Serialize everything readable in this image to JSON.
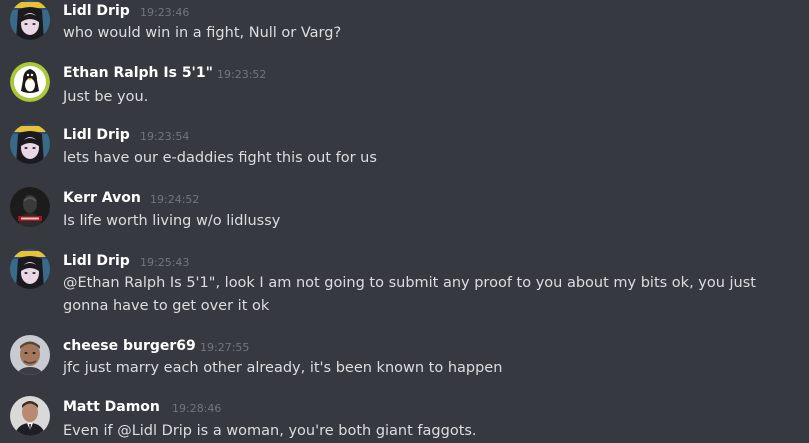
{
  "colors": {
    "background": "#36393f",
    "username": "#ffffff",
    "text": "#dcddde",
    "timestamp": "#72767d"
  },
  "messages": [
    {
      "author": "Lidl Drip",
      "time": "19:23:46",
      "text": "who would win in a fight, Null or Varg?",
      "avatar_icon": "anime-girl-avatar-icon"
    },
    {
      "author": "Ethan Ralph Is 5'1\"",
      "time": "19:23:52",
      "text": "Just be you.",
      "avatar_icon": "penguin-avatar-icon"
    },
    {
      "author": "Lidl Drip",
      "time": "19:23:54",
      "text": "lets have our e-daddies fight this out for us",
      "avatar_icon": "anime-girl-avatar-icon"
    },
    {
      "author": "Kerr Avon",
      "time": "19:24:52",
      "text": "Is life worth living w/o lidlussy",
      "avatar_icon": "dark-figure-avatar-icon"
    },
    {
      "author": "Lidl Drip",
      "time": "19:25:43",
      "text": "@Ethan Ralph Is 5'1\", look I am not going to submit any proof to you about my bits ok, you just gonna have to get over it ok",
      "avatar_icon": "anime-girl-avatar-icon"
    },
    {
      "author": "cheese burger69",
      "time": "19:27:55",
      "text": "jfc just marry each other already, it's been known to happen",
      "avatar_icon": "man-face-avatar-icon"
    },
    {
      "author": "Matt Damon",
      "time": "19:28:46",
      "text": "Even if @Lidl Drip is a woman, you're both giant faggots.",
      "avatar_icon": "suit-man-avatar-icon"
    }
  ]
}
